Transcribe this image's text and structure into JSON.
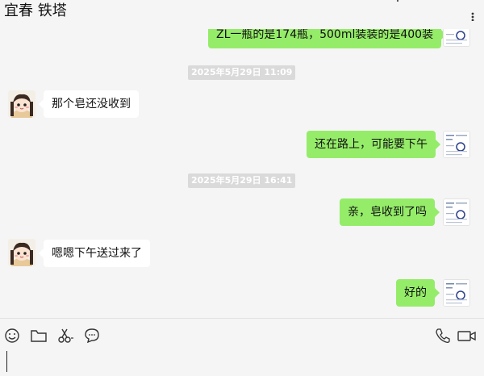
{
  "window": {
    "title": "宜春 铁塔",
    "more_icon": "more-icon"
  },
  "messages": [
    {
      "id": "m0",
      "side": "out",
      "text": "ZL一瓶的是174瓶，500ml装装的是400装"
    },
    {
      "id": "t1",
      "type": "timestamp",
      "text": "2025年5月29日 11:09"
    },
    {
      "id": "m1",
      "side": "in",
      "text": "那个皂还没收到"
    },
    {
      "id": "m2",
      "side": "out",
      "text": "还在路上，可能要下午"
    },
    {
      "id": "t2",
      "type": "timestamp",
      "text": "2025年5月29日 16:41"
    },
    {
      "id": "m3",
      "side": "out",
      "text": "亲，皂收到了吗"
    },
    {
      "id": "m4",
      "side": "in",
      "text": "嗯嗯下午送过来了"
    },
    {
      "id": "m5",
      "side": "out",
      "text": "好的"
    }
  ],
  "toolbar": {
    "left_icons": [
      "emoji-icon",
      "folder-icon",
      "scissors-icon",
      "chat-bubble-icon"
    ],
    "right_icons": [
      "phone-icon",
      "video-icon"
    ]
  },
  "colors": {
    "outgoing_bubble": "#95ec69",
    "incoming_bubble": "#ffffff",
    "background": "#f5f5f5",
    "timestamp_bg": "#dadada"
  }
}
